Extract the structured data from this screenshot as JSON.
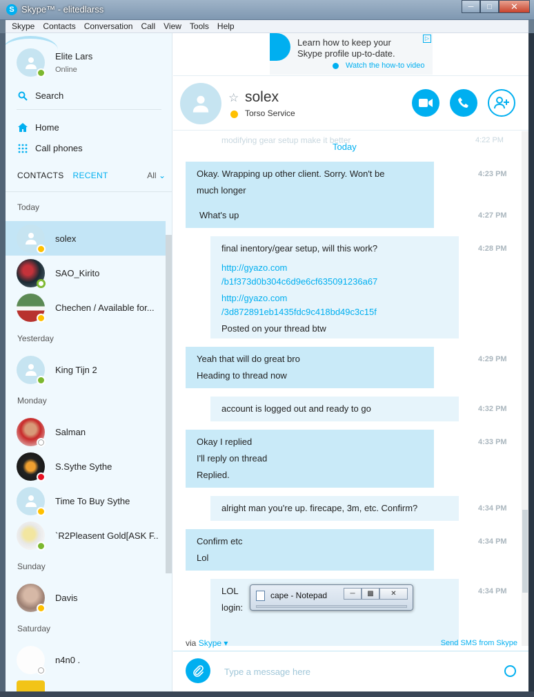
{
  "window": {
    "title": "Skype™ - elitedlarss",
    "app_icon": "S"
  },
  "menu": [
    "Skype",
    "Contacts",
    "Conversation",
    "Call",
    "View",
    "Tools",
    "Help"
  ],
  "me": {
    "name": "Elite Lars",
    "status": "Online"
  },
  "sidebar": {
    "search_label": "Search",
    "home_label": "Home",
    "call_phones_label": "Call phones",
    "tab_contacts": "CONTACTS",
    "tab_recent": "RECENT",
    "filter": "All"
  },
  "contact_groups": [
    {
      "label": "Today",
      "contacts": [
        {
          "name": "solex",
          "status": "away",
          "selected": true
        },
        {
          "name": "SAO_Kirito",
          "status": "offline"
        },
        {
          "name": "Chechen / Available for...",
          "status": "away"
        }
      ]
    },
    {
      "label": "Yesterday",
      "contacts": [
        {
          "name": "King Tijn 2",
          "status": "online"
        }
      ]
    },
    {
      "label": "Monday",
      "contacts": [
        {
          "name": "Salman",
          "status": "unknown"
        },
        {
          "name": "S.Sythe Sythe",
          "status": "dnd"
        },
        {
          "name": "Time To Buy Sythe",
          "status": "away"
        },
        {
          "name": "`R2Pleasent Gold[ASK F...",
          "status": "online"
        }
      ]
    },
    {
      "label": "Sunday",
      "contacts": [
        {
          "name": "Davis",
          "status": "away"
        }
      ]
    },
    {
      "label": "Saturday",
      "contacts": [
        {
          "name": "n4n0 .",
          "status": "unknown"
        }
      ]
    }
  ],
  "ad": {
    "line1": "Learn how to keep your",
    "line2": "Skype profile up-to-date.",
    "link": "Watch the how-to video"
  },
  "chat": {
    "name": "solex",
    "mood": "Torso Service",
    "ghost_text": "modifying gear setup make it better",
    "ghost_time": "4:22 PM",
    "day_label": "Today"
  },
  "messages": [
    {
      "lines": [
        "Okay. Wrapping up other client. Sorry. Won't be",
        "much longer"
      ],
      "time": "4:23 PM",
      "from": "me"
    },
    {
      "lines": [
        "What's up"
      ],
      "time": "4:27 PM",
      "from": "me"
    },
    {
      "lines": [
        "final inentory/gear setup, will this work?"
      ],
      "links": [
        "http://gyazo.com",
        "/b1f373d0b304c6d9e6cf635091236a67",
        "http://gyazo.com",
        "/3d872891eb1435fdc9c418bd49c3c15f"
      ],
      "after": "Posted on your thread btw",
      "time": "4:28 PM",
      "from": "them"
    },
    {
      "lines": [
        "Yeah that will do great bro",
        "Heading to thread now"
      ],
      "time": "4:29 PM",
      "from": "me"
    },
    {
      "lines": [
        "account is logged out and ready to go"
      ],
      "time": "4:32 PM",
      "from": "them"
    },
    {
      "lines": [
        "Okay I replied",
        "I'll reply on thread",
        "Replied."
      ],
      "time": "4:33 PM",
      "from": "me"
    },
    {
      "lines": [
        "alright man you're up.  firecape, 3m, etc.  Confirm?"
      ],
      "time": "4:34 PM",
      "from": "them"
    },
    {
      "lines": [
        "Confirm etc",
        "Lol"
      ],
      "time": "4:34 PM",
      "from": "me"
    },
    {
      "lines": [
        "LOL",
        "login:"
      ],
      "time": "4:34 PM",
      "from": "them"
    }
  ],
  "footer": {
    "via_prefix": "via",
    "via_link": "Skype",
    "sms_link": "Send SMS from Skype",
    "compose_placeholder": "Type a message here"
  },
  "notepad": {
    "title": "cape - Notepad"
  }
}
